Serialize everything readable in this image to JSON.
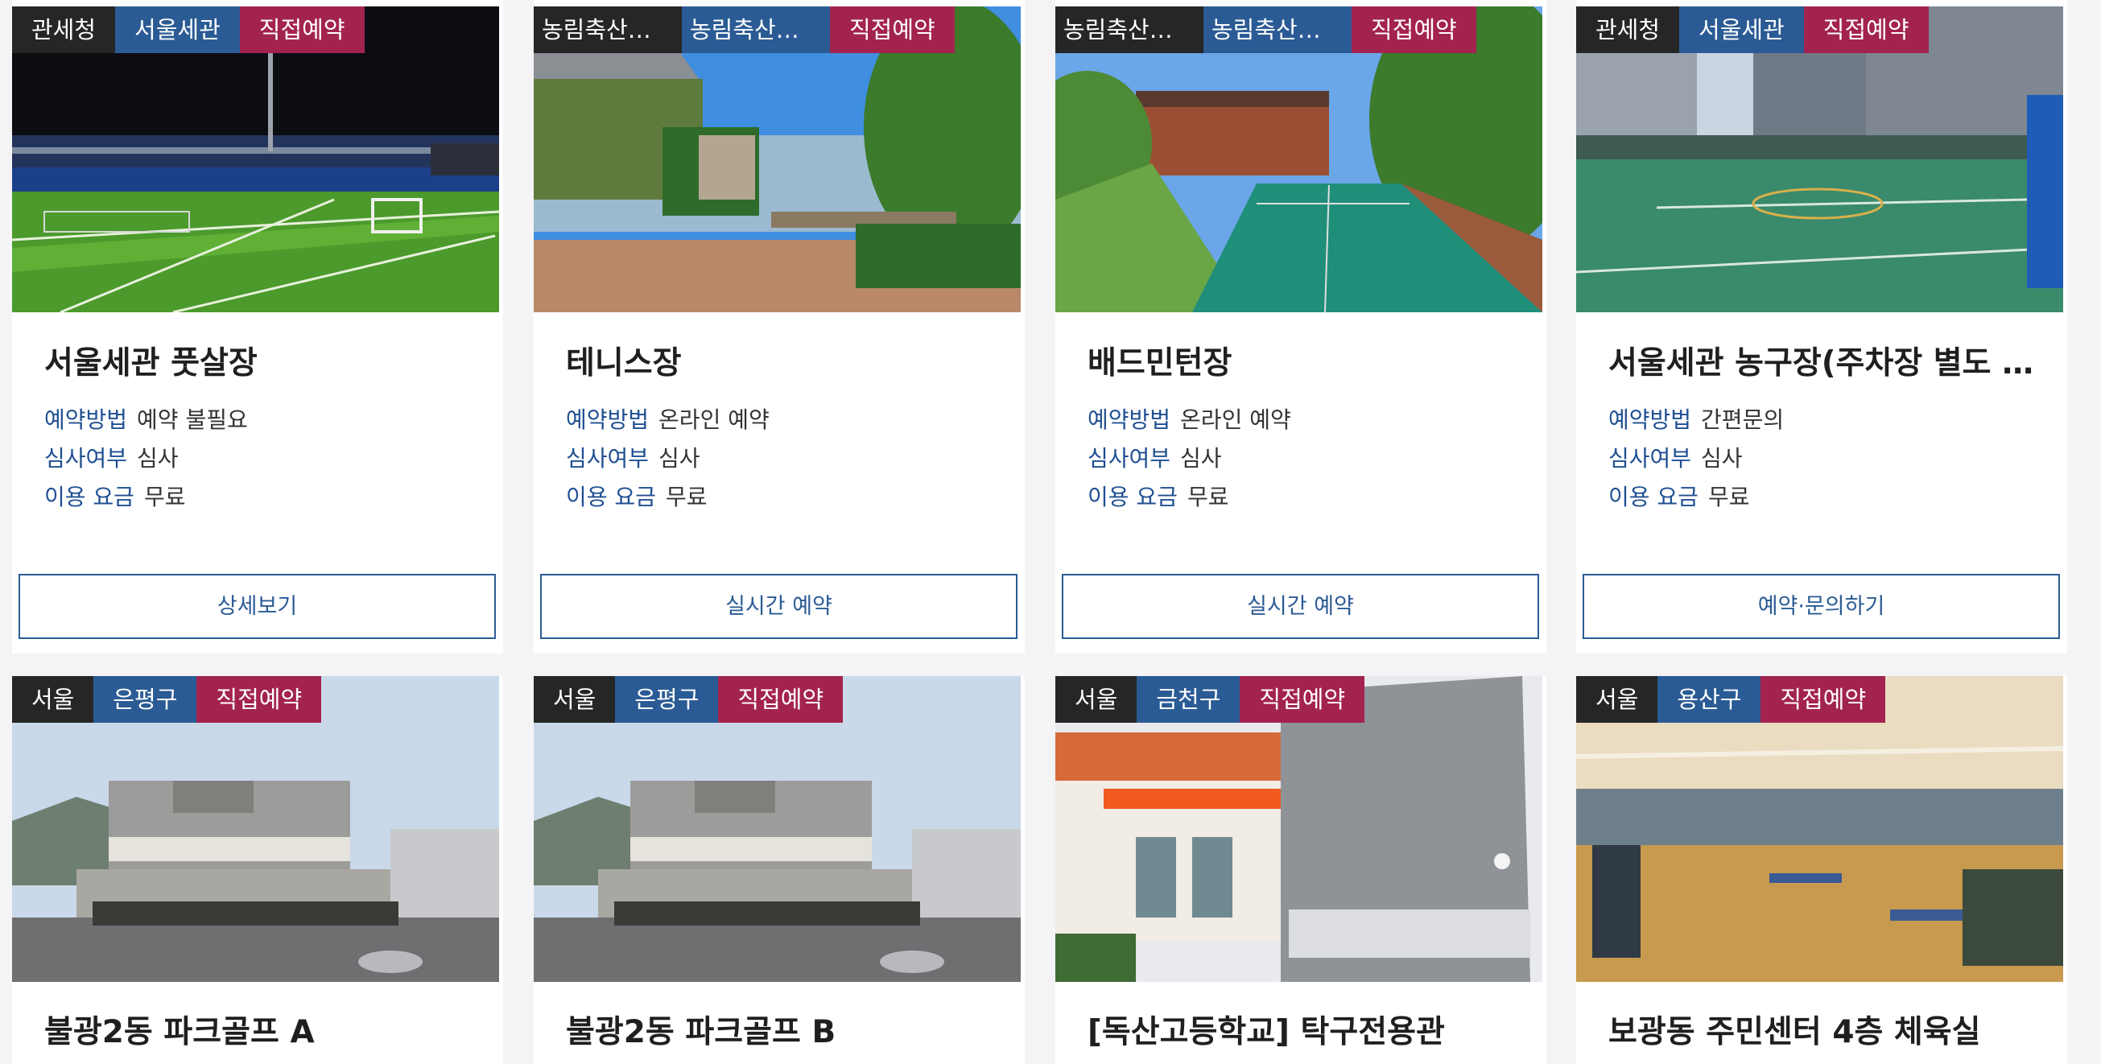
{
  "cards": [
    {
      "tags": [
        "관세청",
        "서울세관",
        "직접예약"
      ],
      "title": "서울세관 풋살장",
      "method_label": "예약방법",
      "method": "예약 불필요",
      "review_label": "심사여부",
      "review": "심사",
      "fee_label": "이용 요금",
      "fee": "무료",
      "button": "상세보기"
    },
    {
      "tags": [
        "농림축산검역본부",
        "농림축산검역본부",
        "직접예약"
      ],
      "title": "테니스장",
      "method_label": "예약방법",
      "method": "온라인 예약",
      "review_label": "심사여부",
      "review": "심사",
      "fee_label": "이용 요금",
      "fee": "무료",
      "button": "실시간 예약"
    },
    {
      "tags": [
        "농림축산검역본부",
        "농림축산검역본부",
        "직접예약"
      ],
      "title": "배드민턴장",
      "method_label": "예약방법",
      "method": "온라인 예약",
      "review_label": "심사여부",
      "review": "심사",
      "fee_label": "이용 요금",
      "fee": "무료",
      "button": "실시간 예약"
    },
    {
      "tags": [
        "관세청",
        "서울세관",
        "직접예약"
      ],
      "title": "서울세관 농구장(주차장 별도 운영)",
      "method_label": "예약방법",
      "method": "간편문의",
      "review_label": "심사여부",
      "review": "심사",
      "fee_label": "이용 요금",
      "fee": "무료",
      "button": "예약·문의하기"
    },
    {
      "tags": [
        "서울",
        "은평구",
        "직접예약"
      ],
      "title": "불광2동 파크골프 A"
    },
    {
      "tags": [
        "서울",
        "은평구",
        "직접예약"
      ],
      "title": "불광2동 파크골프 B"
    },
    {
      "tags": [
        "서울",
        "금천구",
        "직접예약"
      ],
      "title": "[독산고등학교] 탁구전용관"
    },
    {
      "tags": [
        "서울",
        "용산구",
        "직접예약"
      ],
      "title": "보광동 주민센터 4층 체육실"
    }
  ],
  "icons": {
    "img1": "futsal-field-photo",
    "img2": "tennis-court-photo",
    "img3": "badminton-court-photo",
    "img4": "basketball-court-photo",
    "img5": "park-golf-building-photo",
    "img6": "park-golf-building-photo",
    "img7": "table-tennis-hall-photo",
    "img8": "gym-hall-photo"
  }
}
